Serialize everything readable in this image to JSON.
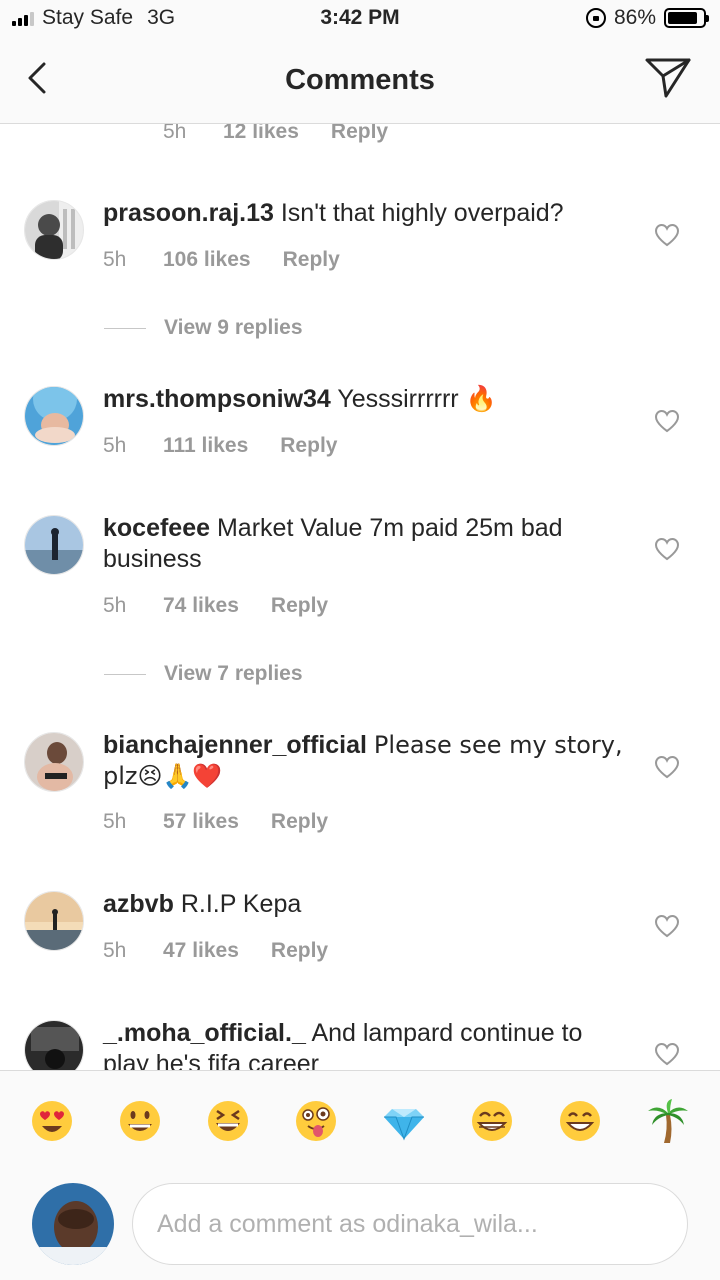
{
  "status_bar": {
    "carrier": "Stay Safe",
    "network": "3G",
    "time": "3:42 PM",
    "battery": "86%",
    "battery_level": 0.86
  },
  "header": {
    "title": "Comments",
    "back_icon": "chevron-left-icon",
    "send_icon": "paper-plane-icon"
  },
  "top_partial": {
    "time": "5h",
    "likes": "12 likes",
    "reply": "Reply"
  },
  "comments": [
    {
      "username": "prasoon.raj.13",
      "text": "Isn't that highly overpaid?",
      "time": "5h",
      "likes": "106 likes",
      "reply": "Reply",
      "view_replies": "View 9 replies"
    },
    {
      "username": "mrs.thompsoniw34",
      "text": "Yesssirrrrrr 🔥",
      "time": "5h",
      "likes": "111 likes",
      "reply": "Reply"
    },
    {
      "username": "kocefeee",
      "text": "Market Value 7m paid 25m bad business",
      "time": "5h",
      "likes": "74 likes",
      "reply": "Reply",
      "view_replies": "View 7 replies"
    },
    {
      "username": "bianchajenner_official",
      "text": "Please see my story, plz😣🙏❤️",
      "time": "5h",
      "likes": "57 likes",
      "reply": "Reply"
    },
    {
      "username": "azbvb",
      "text": "R.I.P Kepa",
      "time": "5h",
      "likes": "47 likes",
      "reply": "Reply"
    },
    {
      "username": "_.moha_official._",
      "text": "And lampard continue to play he's fifa career"
    }
  ],
  "quick_emojis": [
    "heart-eyes-emoji",
    "grinning-emoji",
    "laughing-squint-emoji",
    "winking-tongue-emoji",
    "diamond-emoji",
    "beaming-emoji",
    "smile-emoji",
    "palm-tree-emoji"
  ],
  "composer": {
    "placeholder": "Add a comment as odinaka_wila..."
  },
  "colors": {
    "muted": "#999999",
    "text": "#262626",
    "divider": "#dbdbdb"
  }
}
